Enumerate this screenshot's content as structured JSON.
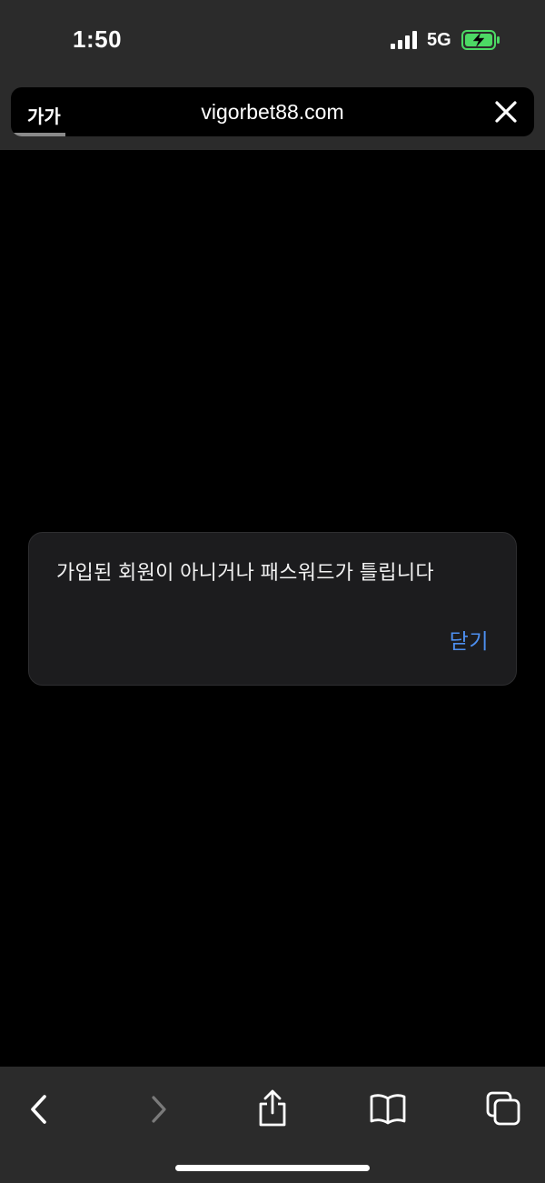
{
  "status_bar": {
    "time": "1:50",
    "network": "5G",
    "battery_state": "charging",
    "battery_color": "#4cd964"
  },
  "browser": {
    "text_size_label": "가가",
    "url": "vigorbet88.com"
  },
  "alert": {
    "message": "가입된 회원이 아니거나 패스워드가 틀립니다",
    "close_label": "닫기",
    "accent_color": "#4d8ff0"
  },
  "toolbar": {
    "icons": [
      "back-icon",
      "forward-icon",
      "share-icon",
      "bookmarks-icon",
      "tabs-icon"
    ]
  }
}
